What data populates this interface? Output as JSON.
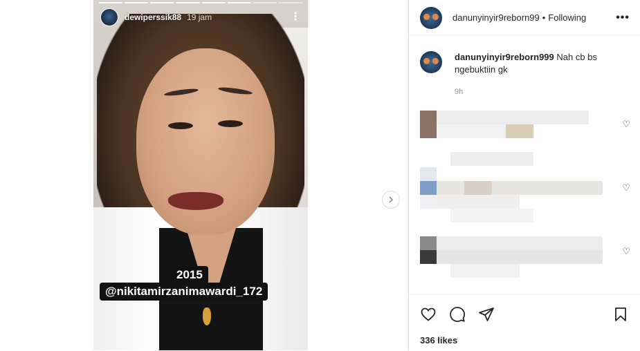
{
  "story": {
    "username": "dewiperssik88",
    "time": "19 jam",
    "progress_segments": 8,
    "progress_done": 6,
    "sticker_year": "2015",
    "sticker_mention": "@nikitamirzanimawardi_172"
  },
  "header": {
    "username": "danunyinyir9reborn99",
    "dot": "•",
    "follow_label": "Following",
    "more": "•••"
  },
  "caption": {
    "username": "danunyinyir9reborn999",
    "text": "Nah cb bs ngebuktiin gk",
    "time": "9h"
  },
  "likes": "336 likes",
  "icons": {
    "story_more": "vertical-dots-icon",
    "next": "chevron-right-icon",
    "like": "heart-icon",
    "comment": "comment-bubble-icon",
    "share": "paper-plane-icon",
    "save": "bookmark-icon"
  }
}
